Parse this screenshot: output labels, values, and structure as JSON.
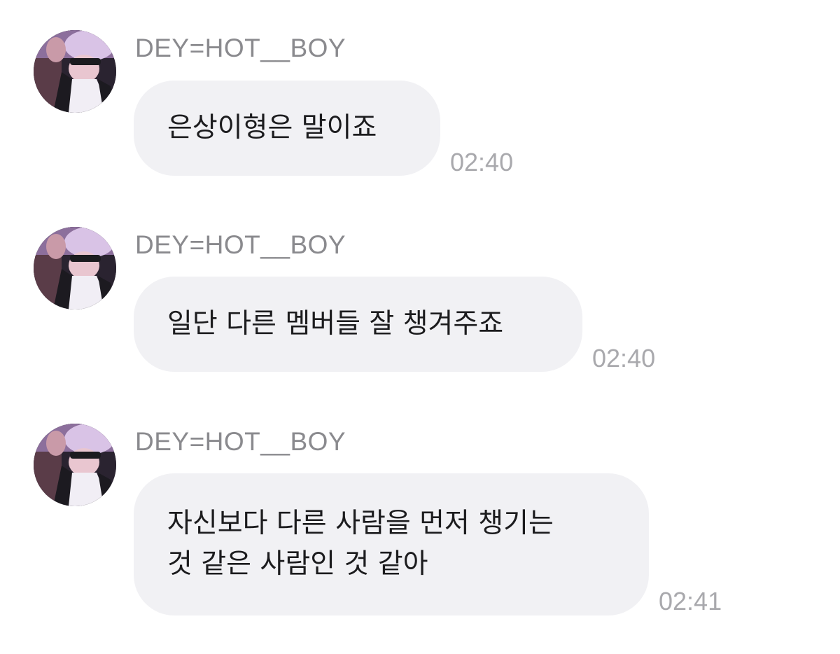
{
  "colors": {
    "background": "#ffffff",
    "bubble": "#f1f1f4",
    "sender_text": "#8a8a8e",
    "time_text": "#a9a9ad",
    "message_text": "#1c1c1e"
  },
  "messages": [
    {
      "sender": "DEY=HOT__BOY",
      "avatar_icon": "profile-photo",
      "lines": [
        "은상이형은 말이죠"
      ],
      "time": "02:40"
    },
    {
      "sender": "DEY=HOT__BOY",
      "avatar_icon": "profile-photo",
      "lines": [
        "일단 다른 멤버들 잘 챙겨주죠"
      ],
      "time": "02:40"
    },
    {
      "sender": "DEY=HOT__BOY",
      "avatar_icon": "profile-photo",
      "lines": [
        "자신보다 다른 사람을 먼저 챙기는",
        "것 같은 사람인 것 같아"
      ],
      "time": "02:41"
    }
  ]
}
